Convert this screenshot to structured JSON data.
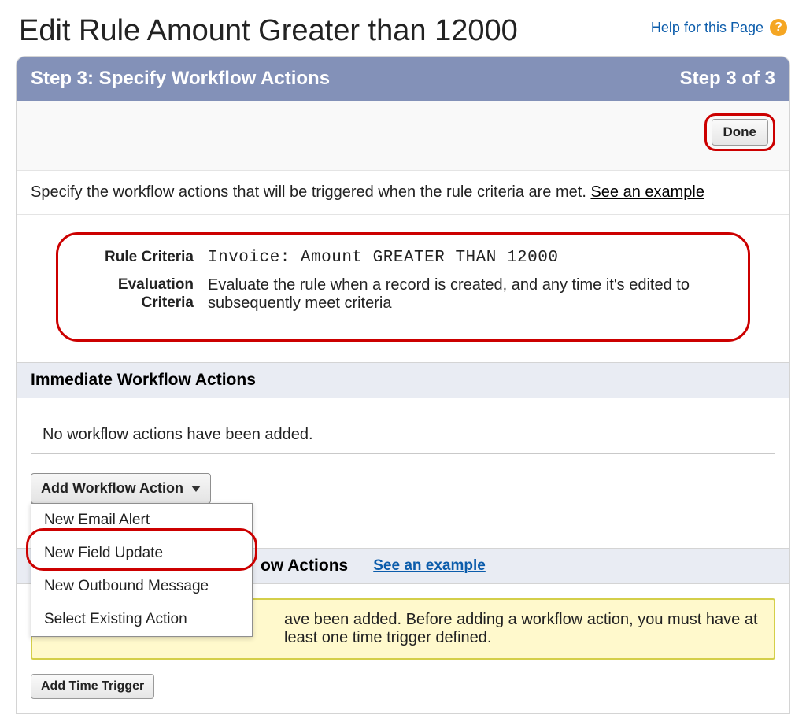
{
  "header": {
    "title": "Edit Rule Amount Greater than 12000",
    "help_label": "Help for this Page"
  },
  "step_bar": {
    "title": "Step 3: Specify Workflow Actions",
    "counter": "Step 3 of 3"
  },
  "done_button": "Done",
  "intro": {
    "text": "Specify the workflow actions that will be triggered when the rule criteria are met. ",
    "link": "See an example"
  },
  "criteria": {
    "rule_label": "Rule Criteria",
    "rule_value": "Invoice: Amount GREATER THAN 12000",
    "eval_label": "Evaluation Criteria",
    "eval_value": "Evaluate the rule when a record is created, and any time it's edited to subsequently meet criteria"
  },
  "immediate": {
    "header": "Immediate Workflow Actions",
    "empty": "No workflow actions have been added.",
    "dropdown_label": "Add Workflow Action",
    "menu": {
      "new_email_alert": "New Email Alert",
      "new_field_update": "New Field Update",
      "new_outbound_message": "New Outbound Message",
      "select_existing": "Select Existing Action"
    }
  },
  "time_dep": {
    "header_suffix": "ow Actions",
    "see_example": "See an example",
    "info": "ave been added. Before adding a workflow action, you must have at least one time trigger defined.",
    "add_trigger": "Add Time Trigger"
  }
}
